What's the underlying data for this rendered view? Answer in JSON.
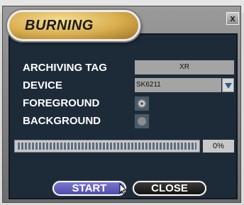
{
  "dialog": {
    "title": "BURNING",
    "close_label": "x"
  },
  "form": {
    "archiving_tag": {
      "label": "ARCHIVING TAG",
      "value": "XR"
    },
    "device": {
      "label": "DEVICE",
      "value": "SK6211"
    },
    "foreground": {
      "label": "FOREGROUND",
      "selected": true
    },
    "background": {
      "label": "BACKGROUND",
      "selected": false
    }
  },
  "progress": {
    "fraction": 1.0,
    "percent_text": "0%"
  },
  "buttons": {
    "start": "START",
    "close": "CLOSE"
  },
  "icons": {
    "dropdown": "chevron-down-icon",
    "pointer": "mouse-cursor-icon"
  }
}
